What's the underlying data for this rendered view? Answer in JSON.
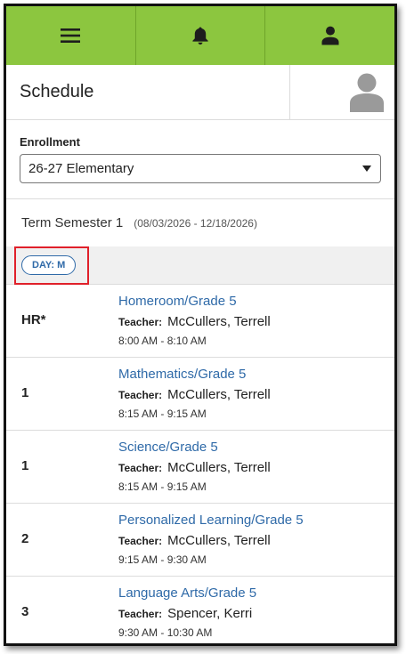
{
  "nav": {
    "menu_icon": "hamburger-menu-icon",
    "notifications_icon": "bell-icon",
    "profile_icon": "person-icon"
  },
  "header": {
    "title": "Schedule",
    "avatar_icon": "avatar-placeholder-icon"
  },
  "enrollment": {
    "label": "Enrollment",
    "selected": "26-27 Elementary"
  },
  "term": {
    "name": "Term Semester 1",
    "dates": "(08/03/2026 - 12/18/2026)"
  },
  "day_filter": {
    "label": "DAY: M"
  },
  "schedule": [
    {
      "period": "HR*",
      "course": "Homeroom/Grade 5",
      "teacher_label": "Teacher:",
      "teacher": "McCullers, Terrell",
      "time": "8:00 AM - 8:10 AM"
    },
    {
      "period": "1",
      "course": "Mathematics/Grade 5",
      "teacher_label": "Teacher:",
      "teacher": "McCullers, Terrell",
      "time": "8:15 AM - 9:15 AM"
    },
    {
      "period": "1",
      "course": "Science/Grade 5",
      "teacher_label": "Teacher:",
      "teacher": "McCullers, Terrell",
      "time": "8:15 AM - 9:15 AM"
    },
    {
      "period": "2",
      "course": "Personalized Learning/Grade 5",
      "teacher_label": "Teacher:",
      "teacher": "McCullers, Terrell",
      "time": "9:15 AM - 9:30 AM"
    },
    {
      "period": "3",
      "course": "Language Arts/Grade 5",
      "teacher_label": "Teacher:",
      "teacher": "Spencer, Kerri",
      "time": "9:30 AM - 10:30 AM"
    }
  ],
  "colors": {
    "topbar": "#8cc63f",
    "link": "#2f6aa8",
    "highlight": "#e0202a"
  }
}
